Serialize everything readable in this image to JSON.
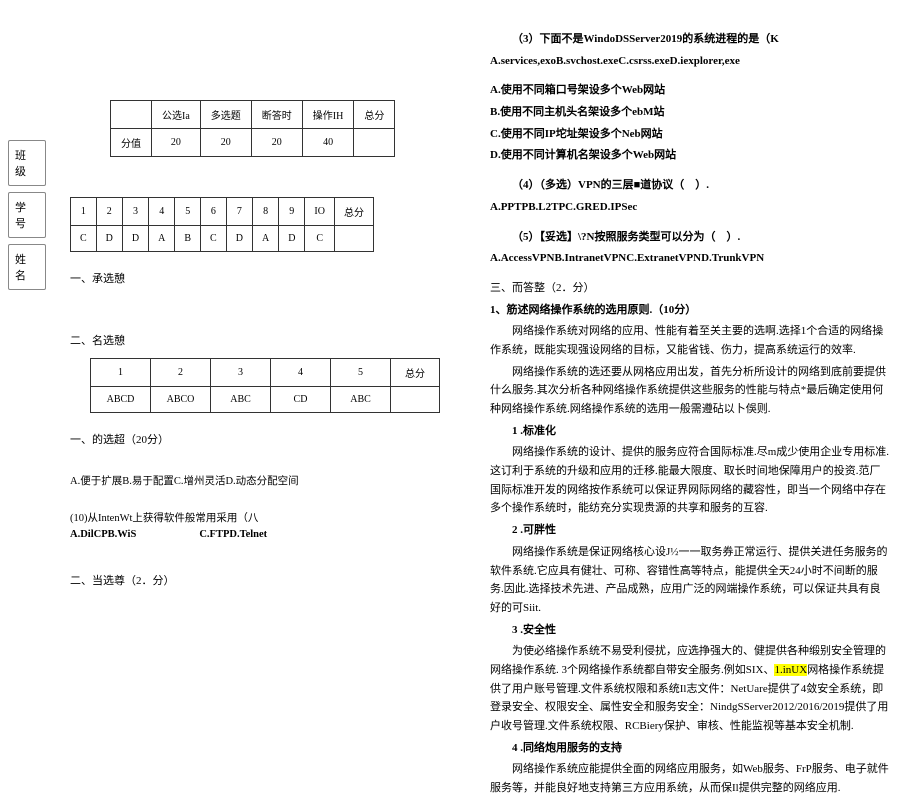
{
  "left": {
    "sideLabels": [
      "班 级",
      "学 号",
      "姓 名"
    ],
    "table1": {
      "headers": [
        "",
        "公选Ia",
        "多选题",
        "断答时",
        "操作IH",
        "总分"
      ],
      "row1": [
        "分值",
        "20",
        "20",
        "20",
        "40",
        ""
      ]
    },
    "table2": {
      "headers": [
        "1",
        "2",
        "3",
        "4",
        "5",
        "6",
        "7",
        "8",
        "9",
        "IO",
        "总分"
      ],
      "row1": [
        "C",
        "D",
        "D",
        "A",
        "B",
        "C",
        "D",
        "A",
        "D",
        "C",
        ""
      ]
    },
    "table3": {
      "headers": [
        "1",
        "2",
        "3",
        "4",
        "5",
        "总分"
      ],
      "row1": [
        "ABCD",
        "ABCO",
        "ABC",
        "CD",
        "ABC",
        ""
      ]
    },
    "h1": "一、承选憩",
    "h2": "二、名选憩",
    "h3": "一、的选超（20分）",
    "opt1": "A.便于扩展B.易于配置C.增州灵活D.动态分配空间",
    "q10": "(10)从IntenWt上获得软件般常用采用（八",
    "q10opts": "A.DilCPB.WiS                        C.FTPD.Telnet",
    "h4": "二、当选尊（2．分）"
  },
  "right": {
    "q3title": "（3）下面不是WindoDSServer2019的系统进程的是（K",
    "q3opts": "A.services,exoB.svchost.exeC.csrss.exeD.iexplorer,exe",
    "q3a": "A.使用不同箱口号架设多个Web网站",
    "q3b": "B.使用不同主机头名架设多个ebM站",
    "q3c": "C.使用不同IP坨址架设多个Neb网站",
    "q3d": "D.使用不同计算机名架设多个Web网站",
    "q4": "（4）（多选）VPN的三层■道协议（　）.",
    "q4opts": "A.PPTPB.L2TPC.GRED.IPSec",
    "q5": "（5）【妥选】\\?N按照服务类型可以分为（　）.",
    "q5opts": "A.AccessVPNB.IntranetVPNC.ExtranetVPND.TrunkVPN",
    "h1": "三、而答整（2．分）",
    "p1": "1、筋述网络操作系统的选用原则.（10分）",
    "p1_1": "网络操作系统对网络的应用、性能有着至关主要的选啊.选择1个合适的网络操作系统，既能实现强设网络的目标，又能省钱、伤力，提高系统运行的效率.",
    "p1_2": "网络操作系统的选还要从网格应用出发，首先分析所设计的网络到底前要提供什么服务.其次分析各种网络操作系统提供这些服务的性能与特点*最后确定使用何种网络操作系统.网络操作系统的选用一般需遵砧以卜俁则.",
    "s1": "1 .标准化",
    "s1t": "网络操作系统的设计、提供的服务应符合国际标准.尽m成少使用企业专用标准.这订利于系统的升级和应用的迁移.能最大限度、取长时间地保障用户的投资.范厂国际标准开发的网络按作系统可以保证界网际网络的藏容性，即当一个网络中存在多个操作系统时，能纺充分实现贵源的共享和服务的互容.",
    "s2": "2 .可胖性",
    "s2t": "网络操作系统是保证网络核心设J½一一取务券正常运行、提供关进任务服务的软件系统.它应具有健壮、可称、容错性高等特点，能提供全天24小时不间断的服务.因此.选择技术先进、产品成熟，应用广泛的网端操作系统，可以保证共具有良好的可Siit.",
    "s3": "3 .安全性",
    "s3t1": "为使必络操作系统不易受利侵扰，应选挣强大的、健提供各种缎别安全管理的网络操作系统. 3个网络操作系统都自带安全服务.例如SIX、",
    "s3hl": "1.inUX",
    "s3t2": "网格操作系统提供了用户账号管理.文件系统权限和系统Il志文件：NetUare提供了4敛安全系统，即登录安全、权限安全、属性安全和服务安全：NindgSServer2012/2016/2019提供了用户收号管理.文件系统权限、RCBiery保护、审核、性能监视等基本安全机制.",
    "s4": "4 .同络炮用服务的支持",
    "s4t": "网络操作系统应能提供全面的网络应用服务，如Web服务、FrP服务、电子就件服务等，并能良好地支持第三方应用系统，从而保Il提供完整的网络应用."
  }
}
